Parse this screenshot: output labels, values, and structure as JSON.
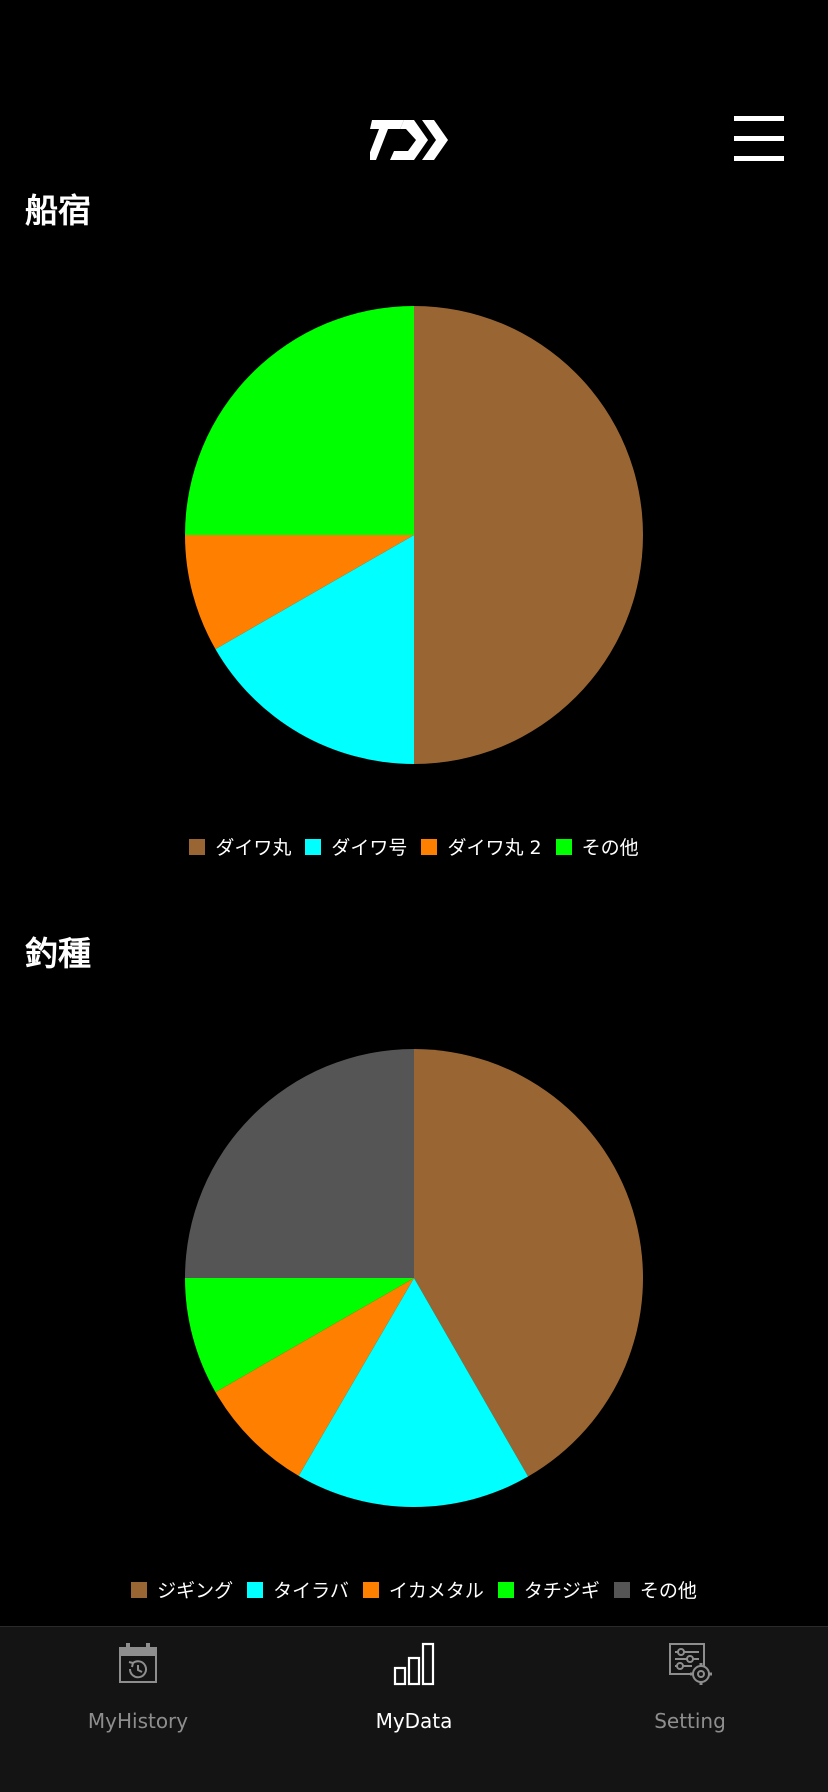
{
  "header": {
    "logo_icon": "daiwa-logo-icon",
    "menu_icon": "hamburger-menu-icon"
  },
  "sections": [
    {
      "title": "船宿",
      "chart_data": {
        "type": "pie",
        "categories": [
          "ダイワ丸",
          "ダイワ号",
          "ダイワ丸 2",
          "その他"
        ],
        "values": [
          50,
          16.7,
          8.3,
          25
        ],
        "colors": [
          "#996633",
          "#00ffff",
          "#ff8000",
          "#00ff00"
        ],
        "start_angle": "top",
        "direction": "clockwise",
        "legend": "bottom-center"
      }
    },
    {
      "title": "釣種",
      "chart_data": {
        "type": "pie",
        "categories": [
          "ジギング",
          "タイラバ",
          "イカメタル",
          "タチジギ",
          "その他"
        ],
        "values": [
          41.7,
          16.7,
          8.3,
          8.3,
          25
        ],
        "colors": [
          "#996633",
          "#00ffff",
          "#ff8000",
          "#00ff00",
          "#555555"
        ],
        "start_angle": "top",
        "direction": "clockwise",
        "legend": "bottom-center"
      }
    }
  ],
  "tabbar": {
    "tabs": [
      {
        "label": "MyHistory",
        "icon": "calendar-history-icon",
        "active": false
      },
      {
        "label": "MyData",
        "icon": "bar-chart-icon",
        "active": true
      },
      {
        "label": "Setting",
        "icon": "settings-sliders-gear-icon",
        "active": false
      }
    ],
    "active_color": "#ffffff",
    "inactive_color": "#8e8e8e"
  }
}
